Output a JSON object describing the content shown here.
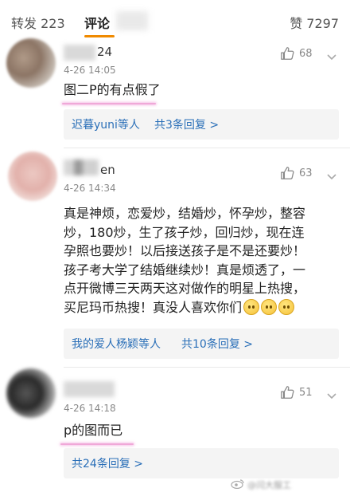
{
  "tabs": {
    "repost_label": "转发 223",
    "comment_label": "评论",
    "like_label": "赞 7297"
  },
  "comments": [
    {
      "name_fragment": "24",
      "time": "4-26 14:05",
      "likes": "68",
      "text": "图二P的有点假了",
      "reply_names": "迟暮yuni等人",
      "reply_count": "共3条回复 >"
    },
    {
      "name_fragment": "en",
      "time": "4-26 14:34",
      "likes": "63",
      "text": "真是神烦，恋爱炒，结婚炒，怀孕炒，整容炒，180炒，生了孩子炒，回归炒，现在连孕照也要炒！以后接送孩子是不是还要炒！孩子考大学了结婚继续炒！真是烦透了，一点开微博三天两天这对做作的明星上热搜，买尼玛币热搜！真没人喜欢你们",
      "reply_names": "我的爱人杨颖等人",
      "reply_count": "共10条回复 >"
    },
    {
      "name_fragment": "",
      "time": "4-26 14:18",
      "likes": "51",
      "text": "p的图而已",
      "reply_names": "",
      "reply_count": "共24条回复 >"
    }
  ],
  "icons": {
    "like": "thumbs-up-icon",
    "more": "chevron-down-icon",
    "emoji": "smiley-emoji"
  },
  "watermark": {
    "prefix": "@",
    "text": "@闫大服工"
  },
  "colors": {
    "link": "#2a6fb8",
    "accent": "#f08a00",
    "highlight": "#f0a8d8"
  }
}
